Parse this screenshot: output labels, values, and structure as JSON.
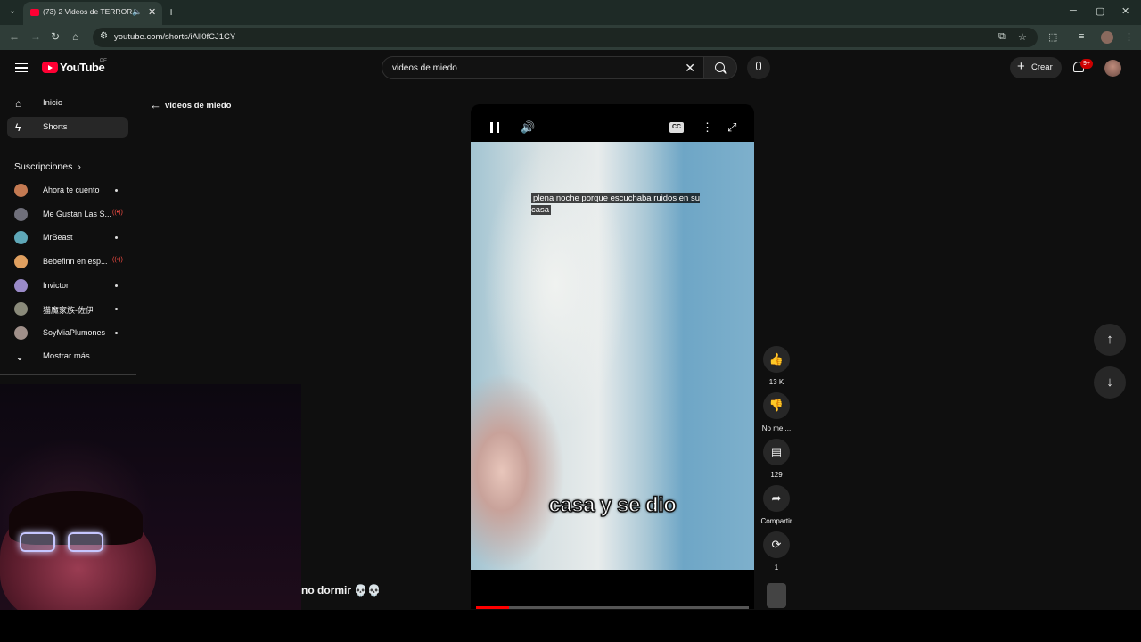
{
  "browser": {
    "tab_title": "(73) 2 Videos de TERROR p",
    "new_tab": "+",
    "url": "youtube.com/shorts/iAll0fCJ1CY"
  },
  "header": {
    "logo_text": "YouTube",
    "country_code": "PE",
    "search_value": "videos de miedo",
    "create_label": "Crear",
    "notifications_badge": "9+"
  },
  "sidebar": {
    "items": [
      {
        "label": "Inicio",
        "icon": "home-icon"
      },
      {
        "label": "Shorts",
        "icon": "shorts-icon"
      }
    ],
    "subscriptions_title": "Suscripciones",
    "subscriptions": [
      {
        "name": "Ahora te cuento",
        "status": "dot",
        "color": "#c47a52"
      },
      {
        "name": "Me Gustan Las S...",
        "status": "live",
        "color": "#6f6f7a"
      },
      {
        "name": "MrBeast",
        "status": "dot",
        "color": "#5fa8b8"
      },
      {
        "name": "Bebefinn en esp...",
        "status": "live",
        "color": "#e0a060"
      },
      {
        "name": "Invictor",
        "status": "dot",
        "color": "#9a8ac8"
      },
      {
        "name": "猫魔家族-佐伊",
        "status": "dot",
        "color": "#8a8a7a"
      },
      {
        "name": "SoyMiaPlumones",
        "status": "dot",
        "color": "#a0908a"
      }
    ],
    "show_more": "Mostrar más"
  },
  "back_link": "videos de miedo",
  "player": {
    "caption_top": "plena noche porque escuchaba ruidos en su casa",
    "caption_big": "casa y se dio",
    "progress": 0.12
  },
  "short_title": "no dormir 💀💀",
  "actions": {
    "like_count": "13 K",
    "dislike_label": "No me ...",
    "comments_count": "129",
    "share_label": "Compartir",
    "remix_count": "1"
  }
}
